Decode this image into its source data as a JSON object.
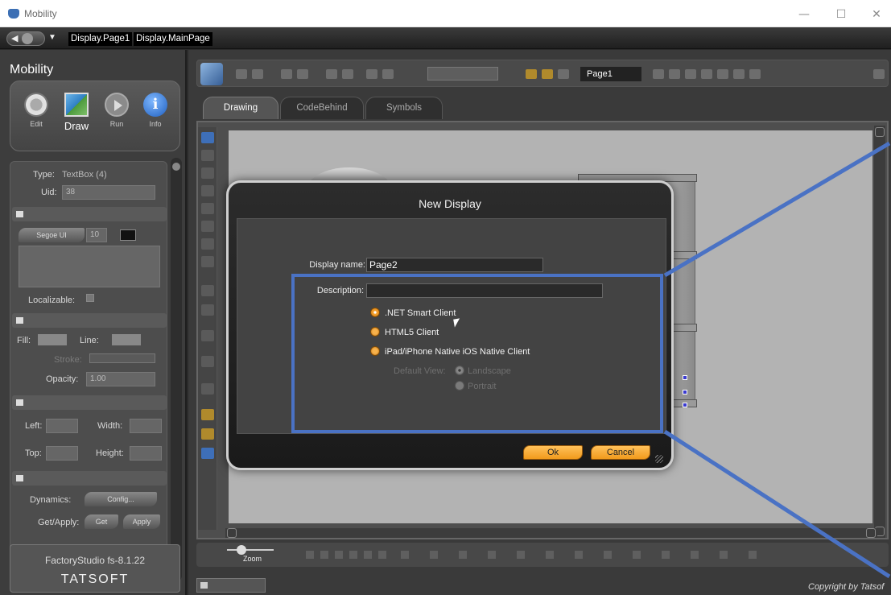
{
  "window": {
    "title": "Mobility",
    "minimize": "—",
    "maximize": "☐",
    "close": "✕"
  },
  "topbar": {
    "page_tabs": [
      "Display.Page1",
      "Display.MainPage"
    ]
  },
  "left": {
    "title": "Mobility",
    "modes": [
      {
        "label": "Edit",
        "icon": "gear-icon"
      },
      {
        "label": "Draw",
        "icon": "draw-icon"
      },
      {
        "label": "Run",
        "icon": "play-icon"
      },
      {
        "label": "Info",
        "icon": "info-icon"
      }
    ],
    "info_glyph": "i",
    "props": {
      "type_label": "Type:",
      "type_value": "TextBox (4)",
      "uid_label": "Uid:",
      "uid_value": "38",
      "font_name": "Segoe UI",
      "font_size": "10",
      "localizable_label": "Localizable:",
      "fill_label": "Fill:",
      "line_label": "Line:",
      "stroke_label": "Stroke:",
      "opacity_label": "Opacity:",
      "opacity_value": "1.00",
      "left_label": "Left:",
      "width_label": "Width:",
      "top_label": "Top:",
      "height_label": "Height:",
      "dynamics_label": "Dynamics:",
      "config_button": "Config...",
      "getapply_label": "Get/Apply:",
      "get_button": "Get",
      "apply_button": "Apply"
    },
    "version": "FactoryStudio fs-8.1.22",
    "brand": "TATSOFT"
  },
  "main": {
    "toolbar": {
      "page_name": "Page1"
    },
    "tabs": [
      "Drawing",
      "CodeBehind",
      "Symbols"
    ],
    "zoom_label": "Zoom",
    "copyright": "Copyright by Tatsof"
  },
  "dialog": {
    "title": "New Display",
    "display_name_label": "Display name:",
    "display_name_value": "Page2",
    "description_label": "Description:",
    "description_value": "",
    "options": [
      ".NET Smart Client",
      "HTML5 Client",
      "iPad/iPhone Native iOS Native Client"
    ],
    "default_view_label": "Default View:",
    "view_options": [
      "Landscape",
      "Portrait"
    ],
    "ok": "Ok",
    "cancel": "Cancel"
  },
  "colors": {
    "accent_orange": "#f19a1c",
    "highlight_blue": "#4a72c4"
  }
}
